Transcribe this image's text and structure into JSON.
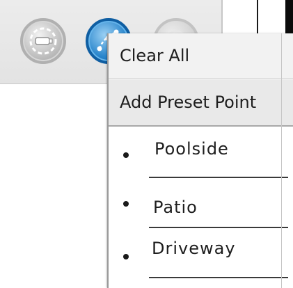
{
  "toolbar": {
    "buttons": [
      {
        "name": "locate-button",
        "icon": "camera-locate-icon",
        "state": "inactive"
      },
      {
        "name": "waypoint-button",
        "icon": "waypoint-path-icon",
        "state": "active",
        "accent": "#2a86cc"
      },
      {
        "name": "misc-button",
        "icon": "misc-icon",
        "state": "inactive"
      }
    ]
  },
  "menu": {
    "clear_all": "Clear All",
    "add_preset": "Add Preset Point",
    "presets": [
      {
        "label": "Poolside"
      },
      {
        "label": "Patio"
      },
      {
        "label": "Driveway"
      }
    ]
  }
}
